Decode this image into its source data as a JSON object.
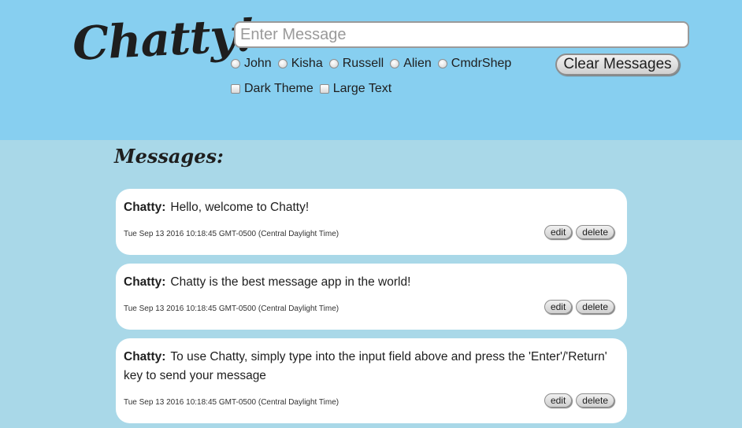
{
  "header": {
    "logo": "Chatty!",
    "input_placeholder": "Enter Message",
    "users": [
      "John",
      "Kisha",
      "Russell",
      "Alien",
      "CmdrShep"
    ],
    "options": [
      "Dark Theme",
      "Large Text"
    ],
    "clear_label": "Clear Messages"
  },
  "main": {
    "heading": "Messages:",
    "messages": [
      {
        "author": "Chatty:",
        "text": "Hello, welcome to Chatty!",
        "timestamp": "Tue Sep 13 2016 10:18:45 GMT-0500 (Central Daylight Time)",
        "edit_label": "edit",
        "delete_label": "delete"
      },
      {
        "author": "Chatty:",
        "text": "Chatty is the best message app in the world!",
        "timestamp": "Tue Sep 13 2016 10:18:45 GMT-0500 (Central Daylight Time)",
        "edit_label": "edit",
        "delete_label": "delete"
      },
      {
        "author": "Chatty:",
        "text": "To use Chatty, simply type into the input field above and press the 'Enter'/'Return' key to send your message",
        "timestamp": "Tue Sep 13 2016 10:18:45 GMT-0500 (Central Daylight Time)",
        "edit_label": "edit",
        "delete_label": "delete"
      }
    ]
  },
  "colors": {
    "header_bg": "#87cff0",
    "body_bg": "#a9d8e8",
    "card_bg": "#ffffff",
    "text": "#1e1e1e"
  }
}
